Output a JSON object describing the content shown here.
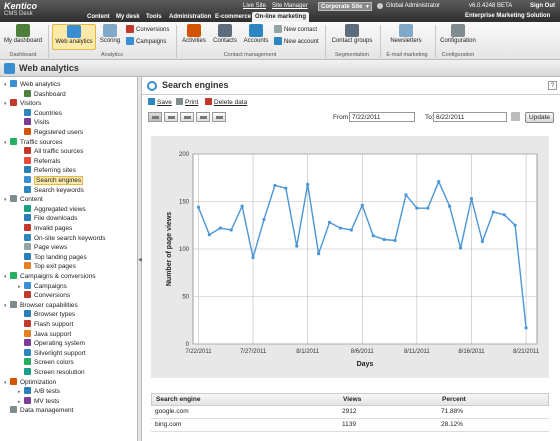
{
  "app": {
    "logo_line1": "Kentico",
    "logo_line2": "CMS Desk",
    "top_tabs": [
      "Content",
      "My desk",
      "Tools",
      "Administration",
      "E-commerce",
      "On-line marketing"
    ],
    "live_site": "Live Site",
    "site_manager": "Site Manager",
    "site_select": "Corporate Site",
    "user": "Global Administrator",
    "version": "v6.0.4248 BETA",
    "sign_out": "Sign Out",
    "ems_label": "Enterprise Marketing Solution"
  },
  "ribbon": {
    "my_dashboard": "My dashboard",
    "web_analytics": "Web analytics",
    "scoring": "Scoring",
    "conversions": "Conversions",
    "campaigns": "Campaigns",
    "activities": "Activities",
    "contacts": "Contacts",
    "accounts": "Accounts",
    "new_contact": "New contact",
    "new_account": "New account",
    "contact_groups": "Contact groups",
    "newsletters": "Newsletters",
    "configuration": "Configuration",
    "groups": {
      "dashboard": "Dashboard",
      "analytics": "Analytics",
      "contact_management": "Contact management",
      "segmentation": "Segmentation",
      "email_marketing": "E-mail marketing",
      "configuration": "Configuration"
    }
  },
  "page_title": "Web analytics",
  "tree": [
    {
      "label": "Web analytics",
      "level": 0,
      "toggle": "-",
      "color": "#3a8fd4"
    },
    {
      "label": "Dashboard",
      "level": 1,
      "toggle": "",
      "color": "#4d7f3b"
    },
    {
      "label": "Visitors",
      "level": 0,
      "toggle": "-",
      "color": "#c0392b"
    },
    {
      "label": "Countries",
      "level": 1,
      "toggle": "",
      "color": "#2e86c1"
    },
    {
      "label": "Visits",
      "level": 1,
      "toggle": "",
      "color": "#7d3c98"
    },
    {
      "label": "Registered users",
      "level": 1,
      "toggle": "",
      "color": "#d35400"
    },
    {
      "label": "Traffic sources",
      "level": 0,
      "toggle": "-",
      "color": "#27ae60"
    },
    {
      "label": "All traffic sources",
      "level": 1,
      "toggle": "",
      "color": "#c0392b"
    },
    {
      "label": "Referrals",
      "level": 1,
      "toggle": "",
      "color": "#e74c3c"
    },
    {
      "label": "Referring sites",
      "level": 1,
      "toggle": "",
      "color": "#2980b9"
    },
    {
      "label": "Search engines",
      "level": 1,
      "toggle": "",
      "color": "#3a8fd4",
      "selected": true
    },
    {
      "label": "Search keywords",
      "level": 1,
      "toggle": "",
      "color": "#2e86c1"
    },
    {
      "label": "Content",
      "level": 0,
      "toggle": "-",
      "color": "#7f8c8d"
    },
    {
      "label": "Aggregated views",
      "level": 1,
      "toggle": "",
      "color": "#16a085"
    },
    {
      "label": "File downloads",
      "level": 1,
      "toggle": "",
      "color": "#2980b9"
    },
    {
      "label": "Invalid pages",
      "level": 1,
      "toggle": "",
      "color": "#c0392b"
    },
    {
      "label": "On-site search keywords",
      "level": 1,
      "toggle": "",
      "color": "#2e86c1"
    },
    {
      "label": "Page views",
      "level": 1,
      "toggle": "",
      "color": "#95a5a6"
    },
    {
      "label": "Top landing pages",
      "level": 1,
      "toggle": "",
      "color": "#2980b9"
    },
    {
      "label": "Top exit pages",
      "level": 1,
      "toggle": "",
      "color": "#e67e22"
    },
    {
      "label": "Campaigns & conversions",
      "level": 0,
      "toggle": "-",
      "color": "#27ae60"
    },
    {
      "label": "Campaigns",
      "level": 1,
      "toggle": "+",
      "color": "#3a8fd4"
    },
    {
      "label": "Conversions",
      "level": 1,
      "toggle": "",
      "color": "#c0392b"
    },
    {
      "label": "Browser capabilities",
      "level": 0,
      "toggle": "-",
      "color": "#7f8c8d"
    },
    {
      "label": "Browser types",
      "level": 1,
      "toggle": "",
      "color": "#2980b9"
    },
    {
      "label": "Flash support",
      "level": 1,
      "toggle": "",
      "color": "#c0392b"
    },
    {
      "label": "Java support",
      "level": 1,
      "toggle": "",
      "color": "#e67e22"
    },
    {
      "label": "Operating system",
      "level": 1,
      "toggle": "",
      "color": "#7d3c98"
    },
    {
      "label": "Silverlight support",
      "level": 1,
      "toggle": "",
      "color": "#2e86c1"
    },
    {
      "label": "Screen colors",
      "level": 1,
      "toggle": "",
      "color": "#27ae60"
    },
    {
      "label": "Screen resolution",
      "level": 1,
      "toggle": "",
      "color": "#16a085"
    },
    {
      "label": "Optimization",
      "level": 0,
      "toggle": "-",
      "color": "#d35400"
    },
    {
      "label": "A/B tests",
      "level": 1,
      "toggle": "+",
      "color": "#2980b9"
    },
    {
      "label": "MV tests",
      "level": 1,
      "toggle": "+",
      "color": "#7d3c98"
    },
    {
      "label": "Data management",
      "level": 0,
      "toggle": "",
      "color": "#7f8c8d"
    }
  ],
  "content": {
    "title": "Search engines",
    "help": "?",
    "save": "Save",
    "print": "Print",
    "delete_data": "Delete data",
    "from_label": "From",
    "from_value": "7/22/2011",
    "to_label": "To:",
    "to_value": "8/22/2011",
    "update": "Update"
  },
  "chart_data": {
    "type": "line",
    "xlabel": "Days",
    "ylabel": "Number of page views",
    "ylim": [
      0,
      200
    ],
    "yticks": [
      0,
      50,
      100,
      150,
      200
    ],
    "x_tick_labels": [
      "7/22/2011",
      "7/27/2011",
      "8/1/2011",
      "8/6/2011",
      "8/11/2011",
      "8/16/2011",
      "8/21/2011"
    ],
    "x_tick_index": [
      0,
      5,
      10,
      15,
      20,
      25,
      30
    ],
    "grid": true,
    "color": "#4b96d6",
    "x": [
      "7/22/2011",
      "7/23/2011",
      "7/24/2011",
      "7/25/2011",
      "7/26/2011",
      "7/27/2011",
      "7/28/2011",
      "7/29/2011",
      "7/30/2011",
      "7/31/2011",
      "8/1/2011",
      "8/2/2011",
      "8/3/2011",
      "8/4/2011",
      "8/5/2011",
      "8/6/2011",
      "8/7/2011",
      "8/8/2011",
      "8/9/2011",
      "8/10/2011",
      "8/11/2011",
      "8/12/2011",
      "8/13/2011",
      "8/14/2011",
      "8/15/2011",
      "8/16/2011",
      "8/17/2011",
      "8/18/2011",
      "8/19/2011",
      "8/20/2011",
      "8/21/2011",
      "8/22/2011"
    ],
    "values": [
      144,
      115,
      122,
      120,
      145,
      91,
      131,
      167,
      164,
      103,
      168,
      95,
      128,
      122,
      120,
      146,
      114,
      110,
      109,
      157,
      143,
      143,
      171,
      145,
      101,
      153,
      108,
      139,
      136,
      125,
      17,
      0
    ],
    "plot_points": 31
  },
  "table": {
    "headers": [
      "Search engine",
      "Views",
      "Percent"
    ],
    "rows": [
      [
        "google.com",
        "2912",
        "71.88%"
      ],
      [
        "bing.com",
        "1139",
        "28.12%"
      ]
    ]
  }
}
